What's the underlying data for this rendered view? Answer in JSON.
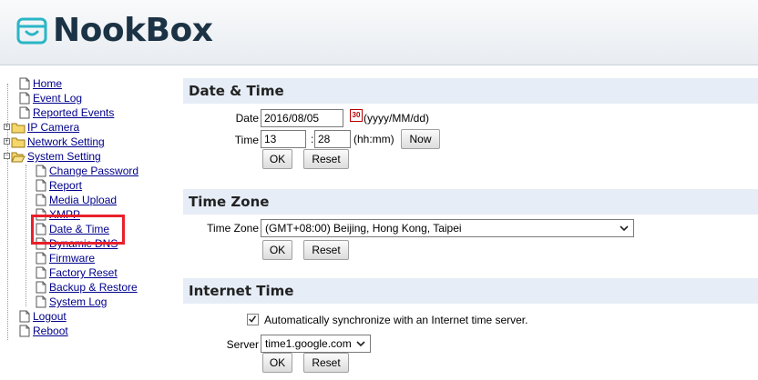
{
  "brand": {
    "name": "NookBox"
  },
  "nav": {
    "items": [
      {
        "label": "Home"
      },
      {
        "label": "Event Log"
      },
      {
        "label": "Reported Events"
      },
      {
        "label": "IP Camera"
      },
      {
        "label": "Network Setting"
      },
      {
        "label": "System Setting"
      },
      {
        "label": "Change Password"
      },
      {
        "label": "Report"
      },
      {
        "label": "Media Upload"
      },
      {
        "label": "XMPP"
      },
      {
        "label": "Date & Time"
      },
      {
        "label": "Dynamic DNS"
      },
      {
        "label": "Firmware"
      },
      {
        "label": "Factory Reset"
      },
      {
        "label": "Backup & Restore"
      },
      {
        "label": "System Log"
      },
      {
        "label": "Logout"
      },
      {
        "label": "Reboot"
      }
    ],
    "highlighted": "Date & Time"
  },
  "date_time": {
    "title": "Date & Time",
    "date_label": "Date",
    "date_value": "2016/08/05",
    "calendar_icon_text": "30",
    "date_hint": "(yyyy/MM/dd)",
    "time_label": "Time",
    "hour_value": "13",
    "separator": ":",
    "minute_value": "28",
    "time_hint": "(hh:mm)",
    "now_label": "Now",
    "ok_label": "OK",
    "reset_label": "Reset"
  },
  "time_zone": {
    "title": "Time Zone",
    "label": "Time Zone",
    "selected": "(GMT+08:00) Beijing, Hong Kong, Taipei",
    "ok_label": "OK",
    "reset_label": "Reset"
  },
  "internet_time": {
    "title": "Internet Time",
    "auto_sync_label": "Automatically synchronize with an Internet time server.",
    "auto_sync_checked": true,
    "server_label": "Server",
    "server_selected": "time1.google.com",
    "ok_label": "OK",
    "reset_label": "Reset"
  },
  "colors": {
    "section_bar": "#e6edf6",
    "link": "#00008b",
    "highlight": "#e8202a",
    "brand_text": "#1b3345"
  }
}
